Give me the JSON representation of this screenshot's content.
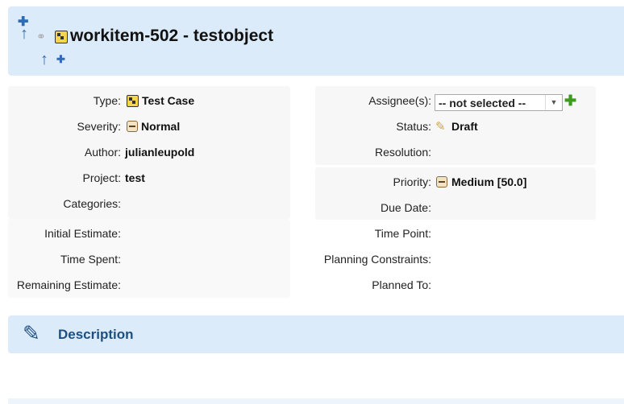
{
  "header": {
    "title": "workitem-502 - testobject",
    "icons": [
      "add-child-icon",
      "move-up-icon",
      "link-icon",
      "test-case-icon",
      "move-up-small-icon",
      "add-small-icon"
    ]
  },
  "fields_left": {
    "type_label": "Type:",
    "type_value": "Test Case",
    "severity_label": "Severity:",
    "severity_value": "Normal",
    "author_label": "Author:",
    "author_value": "julianleupold",
    "project_label": "Project:",
    "project_value": "test",
    "categories_label": "Categories:",
    "initial_estimate_label": "Initial Estimate:",
    "time_spent_label": "Time Spent:",
    "remaining_estimate_label": "Remaining Estimate:"
  },
  "fields_right": {
    "assignee_label": "Assignee(s):",
    "assignee_value": "-- not selected --",
    "status_label": "Status:",
    "status_value": "Draft",
    "resolution_label": "Resolution:",
    "priority_label": "Priority:",
    "priority_value": "Medium [50.0]",
    "due_date_label": "Due Date:",
    "time_point_label": "Time Point:",
    "planning_constraints_label": "Planning Constraints:",
    "planned_to_label": "Planned To:"
  },
  "description": {
    "title": "Description"
  },
  "colors": {
    "panel_blue": "#dcebfa",
    "heading_blue": "#1d4f80",
    "icon_blue": "#2e6db4",
    "add_green": "#3c9a1c"
  }
}
